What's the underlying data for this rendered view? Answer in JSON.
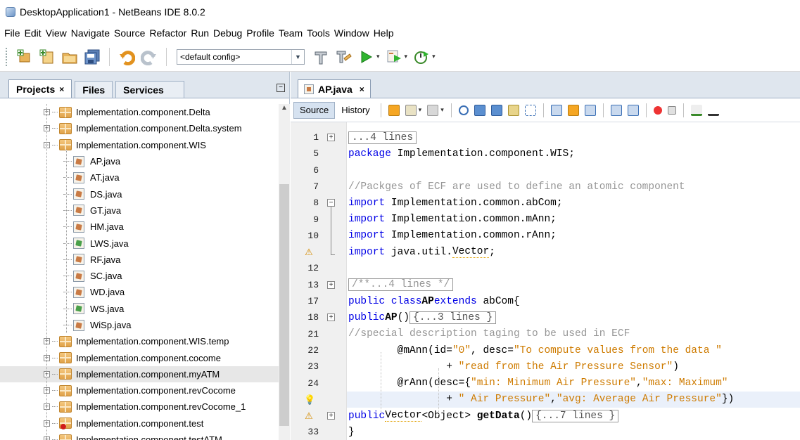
{
  "window": {
    "title": "DesktopApplication1 - NetBeans IDE 8.0.2"
  },
  "menu": [
    "File",
    "Edit",
    "View",
    "Navigate",
    "Source",
    "Refactor",
    "Run",
    "Debug",
    "Profile",
    "Team",
    "Tools",
    "Window",
    "Help"
  ],
  "toolbar": {
    "config_value": "<default config>",
    "icons": [
      "new-project-icon",
      "new-file-icon",
      "open-project-icon",
      "save-all-icon",
      "undo-icon",
      "redo-icon",
      "clean-build-icon",
      "build-icon",
      "run-icon",
      "debug-icon",
      "profile-icon"
    ]
  },
  "projects_panel": {
    "tabs": [
      {
        "label": "Projects",
        "active": true,
        "closable": true,
        "close": "×"
      },
      {
        "label": "Files",
        "active": false
      },
      {
        "label": "Services",
        "active": false
      }
    ],
    "minimize": "−",
    "tree": [
      {
        "label": "Implementation.component.Delta",
        "kind": "package",
        "indent": 0,
        "expander": "+"
      },
      {
        "label": "Implementation.component.Delta.system",
        "kind": "package",
        "indent": 0,
        "expander": "+"
      },
      {
        "label": "Implementation.component.WIS",
        "kind": "package",
        "indent": 0,
        "expander": "−"
      },
      {
        "label": "AP.java",
        "kind": "file",
        "indent": 1
      },
      {
        "label": "AT.java",
        "kind": "file",
        "indent": 1
      },
      {
        "label": "DS.java",
        "kind": "file",
        "indent": 1
      },
      {
        "label": "GT.java",
        "kind": "file",
        "indent": 1
      },
      {
        "label": "HM.java",
        "kind": "file",
        "indent": 1
      },
      {
        "label": "LWS.java",
        "kind": "file-green",
        "indent": 1
      },
      {
        "label": "RF.java",
        "kind": "file",
        "indent": 1
      },
      {
        "label": "SC.java",
        "kind": "file",
        "indent": 1
      },
      {
        "label": "WD.java",
        "kind": "file",
        "indent": 1
      },
      {
        "label": "WS.java",
        "kind": "file-green",
        "indent": 1
      },
      {
        "label": "WiSp.java",
        "kind": "file",
        "indent": 1
      },
      {
        "label": "Implementation.component.WIS.temp",
        "kind": "package",
        "indent": 0,
        "expander": "+"
      },
      {
        "label": "Implementation.component.cocome",
        "kind": "package",
        "indent": 0,
        "expander": "+"
      },
      {
        "label": "Implementation.component.myATM",
        "kind": "package",
        "indent": 0,
        "expander": "+",
        "selected": true
      },
      {
        "label": "Implementation.component.revCocome",
        "kind": "package",
        "indent": 0,
        "expander": "+"
      },
      {
        "label": "Implementation.component.revCocome_1",
        "kind": "package",
        "indent": 0,
        "expander": "+"
      },
      {
        "label": "Implementation.component.test",
        "kind": "package-error",
        "indent": 0,
        "expander": "+"
      },
      {
        "label": "Implementation.component.testATM",
        "kind": "package",
        "indent": 0,
        "expander": "+"
      }
    ]
  },
  "editor": {
    "tab": {
      "label": "AP.java",
      "close": "×"
    },
    "views": [
      "Source",
      "History"
    ],
    "active_view": "Source",
    "lines": [
      {
        "num": "1",
        "fold": "+",
        "text": "...4 lines",
        "style": "fold"
      },
      {
        "num": "5",
        "text": "package Implementation.component.WIS;",
        "style": "package"
      },
      {
        "num": "6",
        "text": ""
      },
      {
        "num": "7",
        "text": "//Packges of ECF are used to define an atomic component",
        "style": "comment"
      },
      {
        "num": "8",
        "fold": "−",
        "text": "import Implementation.common.abCom;",
        "style": "import"
      },
      {
        "num": "9",
        "text": "import Implementation.common.mAnn;",
        "style": "import"
      },
      {
        "num": "10",
        "text": "import Implementation.common.rAnn;",
        "style": "import"
      },
      {
        "num": "",
        "hint": "warning-bulb",
        "text": "import java.util.Vector;",
        "style": "import"
      },
      {
        "num": "12",
        "text": ""
      },
      {
        "num": "13",
        "fold": "+",
        "text": "/**...4 lines */",
        "style": "foldcomment"
      },
      {
        "num": "17",
        "text": "public class AP extends abCom{",
        "style": "class"
      },
      {
        "num": "18",
        "fold": "+",
        "text": "public AP(){...3 lines }",
        "style": "ctor"
      },
      {
        "num": "21",
        "text": "//special description taging to be used in ECF",
        "style": "comment2"
      },
      {
        "num": "22",
        "text": "@mAnn(id=\"0\", desc=\"To compute values from the data \"",
        "style": "ann1"
      },
      {
        "num": "23",
        "text": "+ \"read from the Air Pressure Sensor\")",
        "style": "ann1b"
      },
      {
        "num": "24",
        "text": "@rAnn(desc={\"min: Minimum Air Pressure\",\"max: Maximum\"",
        "style": "ann2"
      },
      {
        "num": "",
        "hint": "bulb",
        "text": "+ \" Air Pressure\",\"avg: Average Air Pressure\"})",
        "style": "ann2b",
        "highlight": true
      },
      {
        "num": "",
        "hint": "warning-bulb",
        "fold": "+",
        "text": "public Vector<Object> getData(){...7 lines }",
        "style": "method"
      },
      {
        "num": "33",
        "text": "}",
        "style": "close"
      }
    ]
  }
}
